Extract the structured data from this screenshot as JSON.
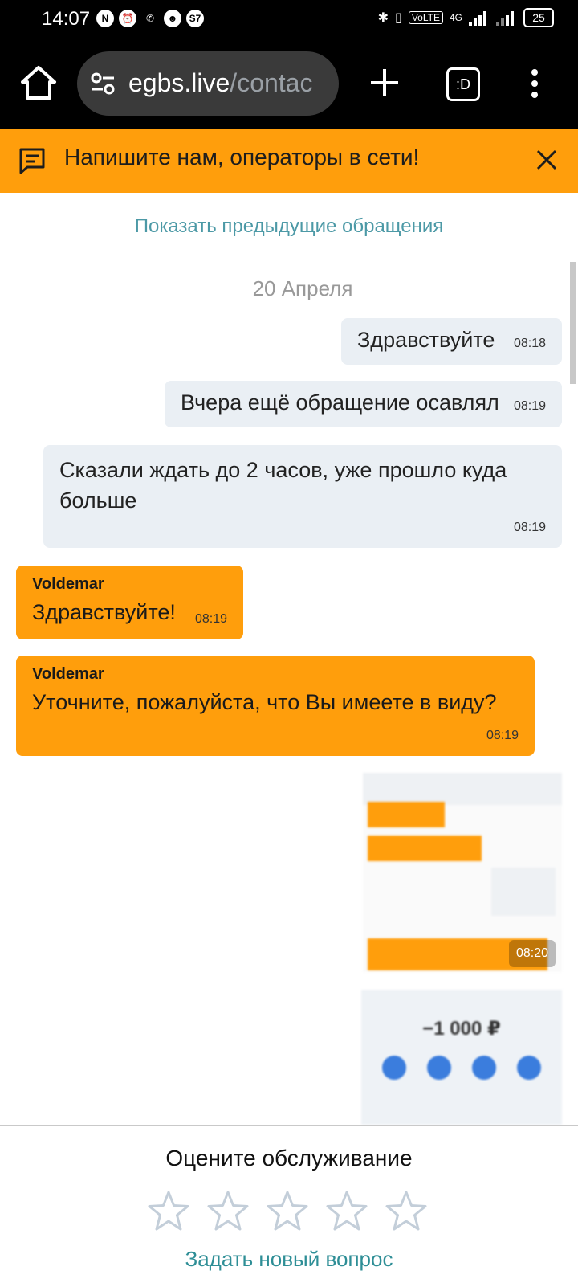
{
  "status_bar": {
    "time": "14:07",
    "network": "VoLTE",
    "network_type": "4G",
    "battery": "25"
  },
  "browser": {
    "url_host": "egbs.live",
    "url_path": "/contac",
    "tab_label": ":D"
  },
  "banner": {
    "text": "Напишите нам, операторы в сети!"
  },
  "chat": {
    "show_previous": "Показать предыдущие обращения",
    "date": "20 Апреля",
    "messages": [
      {
        "text": "Здравствуйте",
        "time": "08:18"
      },
      {
        "text": "Вчера ещё обращение осавлял",
        "time": "08:19"
      },
      {
        "text": "Сказали ждать до 2 часов, уже прошло куда больше",
        "time": "08:19"
      },
      {
        "author": "Voldemar",
        "text": "Здравствуйте!",
        "time": "08:19"
      },
      {
        "author": "Voldemar",
        "text": "Уточните, пожалуйста, что Вы имеете в виду?",
        "time": "08:19"
      }
    ],
    "image1_time": "08:20",
    "image2_amount": "−1 000 ₽"
  },
  "footer": {
    "rate_title": "Оцените обслуживание",
    "stars_total": 5,
    "stars_selected": 0,
    "new_question": "Задать новый вопрос"
  },
  "colors": {
    "accent_orange": "#ff9e0c",
    "link_teal": "#4c99a6",
    "bubble_gray": "#eaeff4"
  }
}
